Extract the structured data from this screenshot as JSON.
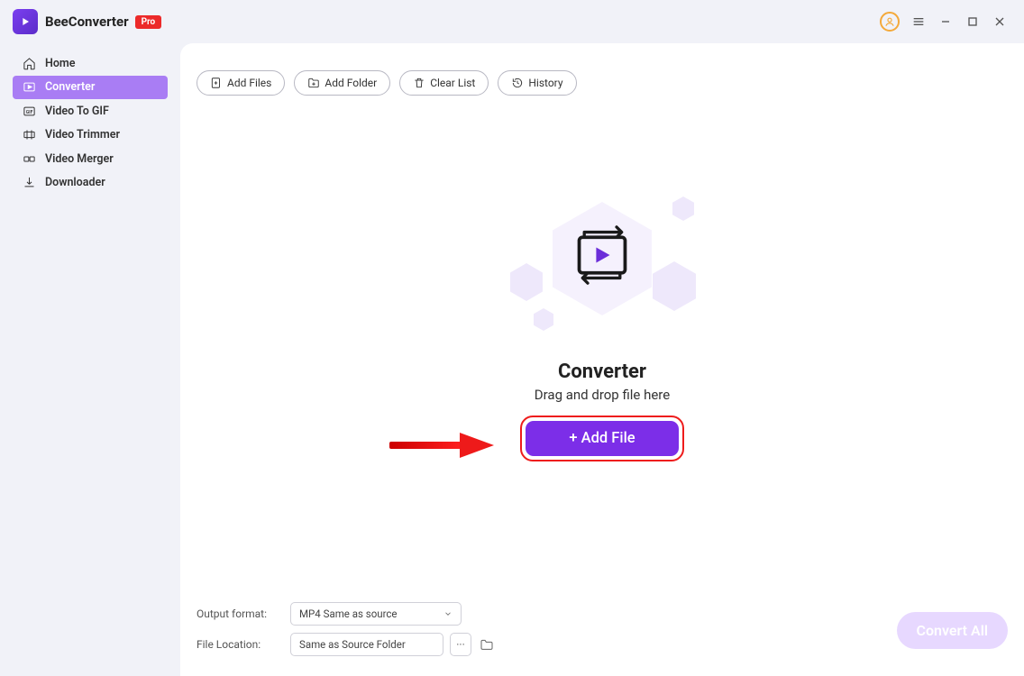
{
  "app": {
    "title": "BeeConverter",
    "badge": "Pro"
  },
  "sidebar": {
    "items": [
      {
        "label": "Home"
      },
      {
        "label": "Converter"
      },
      {
        "label": "Video To GIF"
      },
      {
        "label": "Video Trimmer"
      },
      {
        "label": "Video Merger"
      },
      {
        "label": "Downloader"
      }
    ]
  },
  "toolbar": {
    "add_files": "Add Files",
    "add_folder": "Add Folder",
    "clear_list": "Clear List",
    "history": "History"
  },
  "dropzone": {
    "title": "Converter",
    "subtitle": "Drag and drop file here",
    "button": "+ Add File"
  },
  "bottom": {
    "output_label": "Output format:",
    "output_value": "MP4 Same as source",
    "location_label": "File Location:",
    "location_value": "Same as Source Folder",
    "more": "···",
    "convert_all": "Convert All"
  }
}
